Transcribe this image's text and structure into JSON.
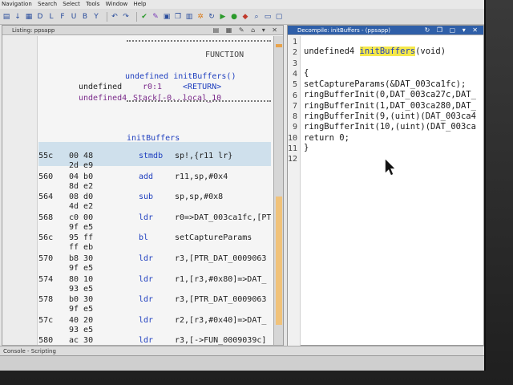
{
  "menu": [
    "Navigation",
    "Search",
    "Select",
    "Tools",
    "Window",
    "Help"
  ],
  "listing": {
    "title": "Listing: ppsapp",
    "function_banner": "FUNCTION",
    "signature": "undefined initBuffers()",
    "params": [
      {
        "type": "undefined",
        "name": "r0:1",
        "value": "<RETURN>"
      },
      {
        "type": "undefined4",
        "name": "Stack[-0...",
        "value": "local_10"
      }
    ],
    "label": "initBuffers",
    "rows": [
      {
        "addr": "0009055c",
        "bytes": "00 48",
        "bytes2": "2d e9",
        "mnemonic": "stmdb",
        "operand": "sp!,{r11 lr}"
      },
      {
        "addr": "00090560",
        "bytes": "04 b0",
        "bytes2": "8d e2",
        "mnemonic": "add",
        "operand": "r11,sp,#0x4"
      },
      {
        "addr": "00090564",
        "bytes": "08 d0",
        "bytes2": "4d e2",
        "mnemonic": "sub",
        "operand": "sp,sp,#0x8"
      },
      {
        "addr": "00090568",
        "bytes": "c0 00",
        "bytes2": "9f e5",
        "mnemonic": "ldr",
        "operand": "r0=>DAT_003ca1fc,[PT"
      },
      {
        "addr": "0009056c",
        "bytes": "95 ff",
        "bytes2": "ff eb",
        "mnemonic": "bl",
        "operand": "setCaptureParams"
      },
      {
        "addr": "00090570",
        "bytes": "b8 30",
        "bytes2": "9f e5",
        "mnemonic": "ldr",
        "operand": "r3,[PTR_DAT_0009063"
      },
      {
        "addr": "00090574",
        "bytes": "80 10",
        "bytes2": "93 e5",
        "mnemonic": "ldr",
        "operand": "r1,[r3,#0x80]=>DAT_"
      },
      {
        "addr": "00090578",
        "bytes": "b0 30",
        "bytes2": "9f e5",
        "mnemonic": "ldr",
        "operand": "r3,[PTR_DAT_0009063"
      },
      {
        "addr": "0009057c",
        "bytes": "40 20",
        "bytes2": "93 e5",
        "mnemonic": "ldr",
        "operand": "r2,[r3,#0x40]=>DAT_"
      },
      {
        "addr": "00090580",
        "bytes": "ac 30",
        "bytes2": "",
        "mnemonic": "ldr",
        "operand": "r3,[->FUN_0009039c]"
      }
    ]
  },
  "decompile": {
    "title": "Decompile: initBuffers - (ppsapp)",
    "line_numbers": [
      "1",
      "2",
      "3",
      "4",
      "5",
      "6",
      "7",
      "8",
      "9",
      "10",
      "11",
      "12"
    ],
    "sig_type": "undefined4 ",
    "sig_name": "initBuffers",
    "sig_args": "(void)",
    "open_brace": "{",
    "lines": [
      "  setCaptureParams(&DAT_003ca1fc);",
      "  ringBufferInit(0,DAT_003ca27c,DAT_",
      "  ringBufferInit(1,DAT_003ca280,DAT_",
      "  ringBufferInit(9,(uint)(DAT_003ca4",
      "  ringBufferInit(10,(uint)(DAT_003ca",
      "  return 0;"
    ],
    "close_brace": "}"
  },
  "status": {
    "console": "Console - Scripting"
  }
}
